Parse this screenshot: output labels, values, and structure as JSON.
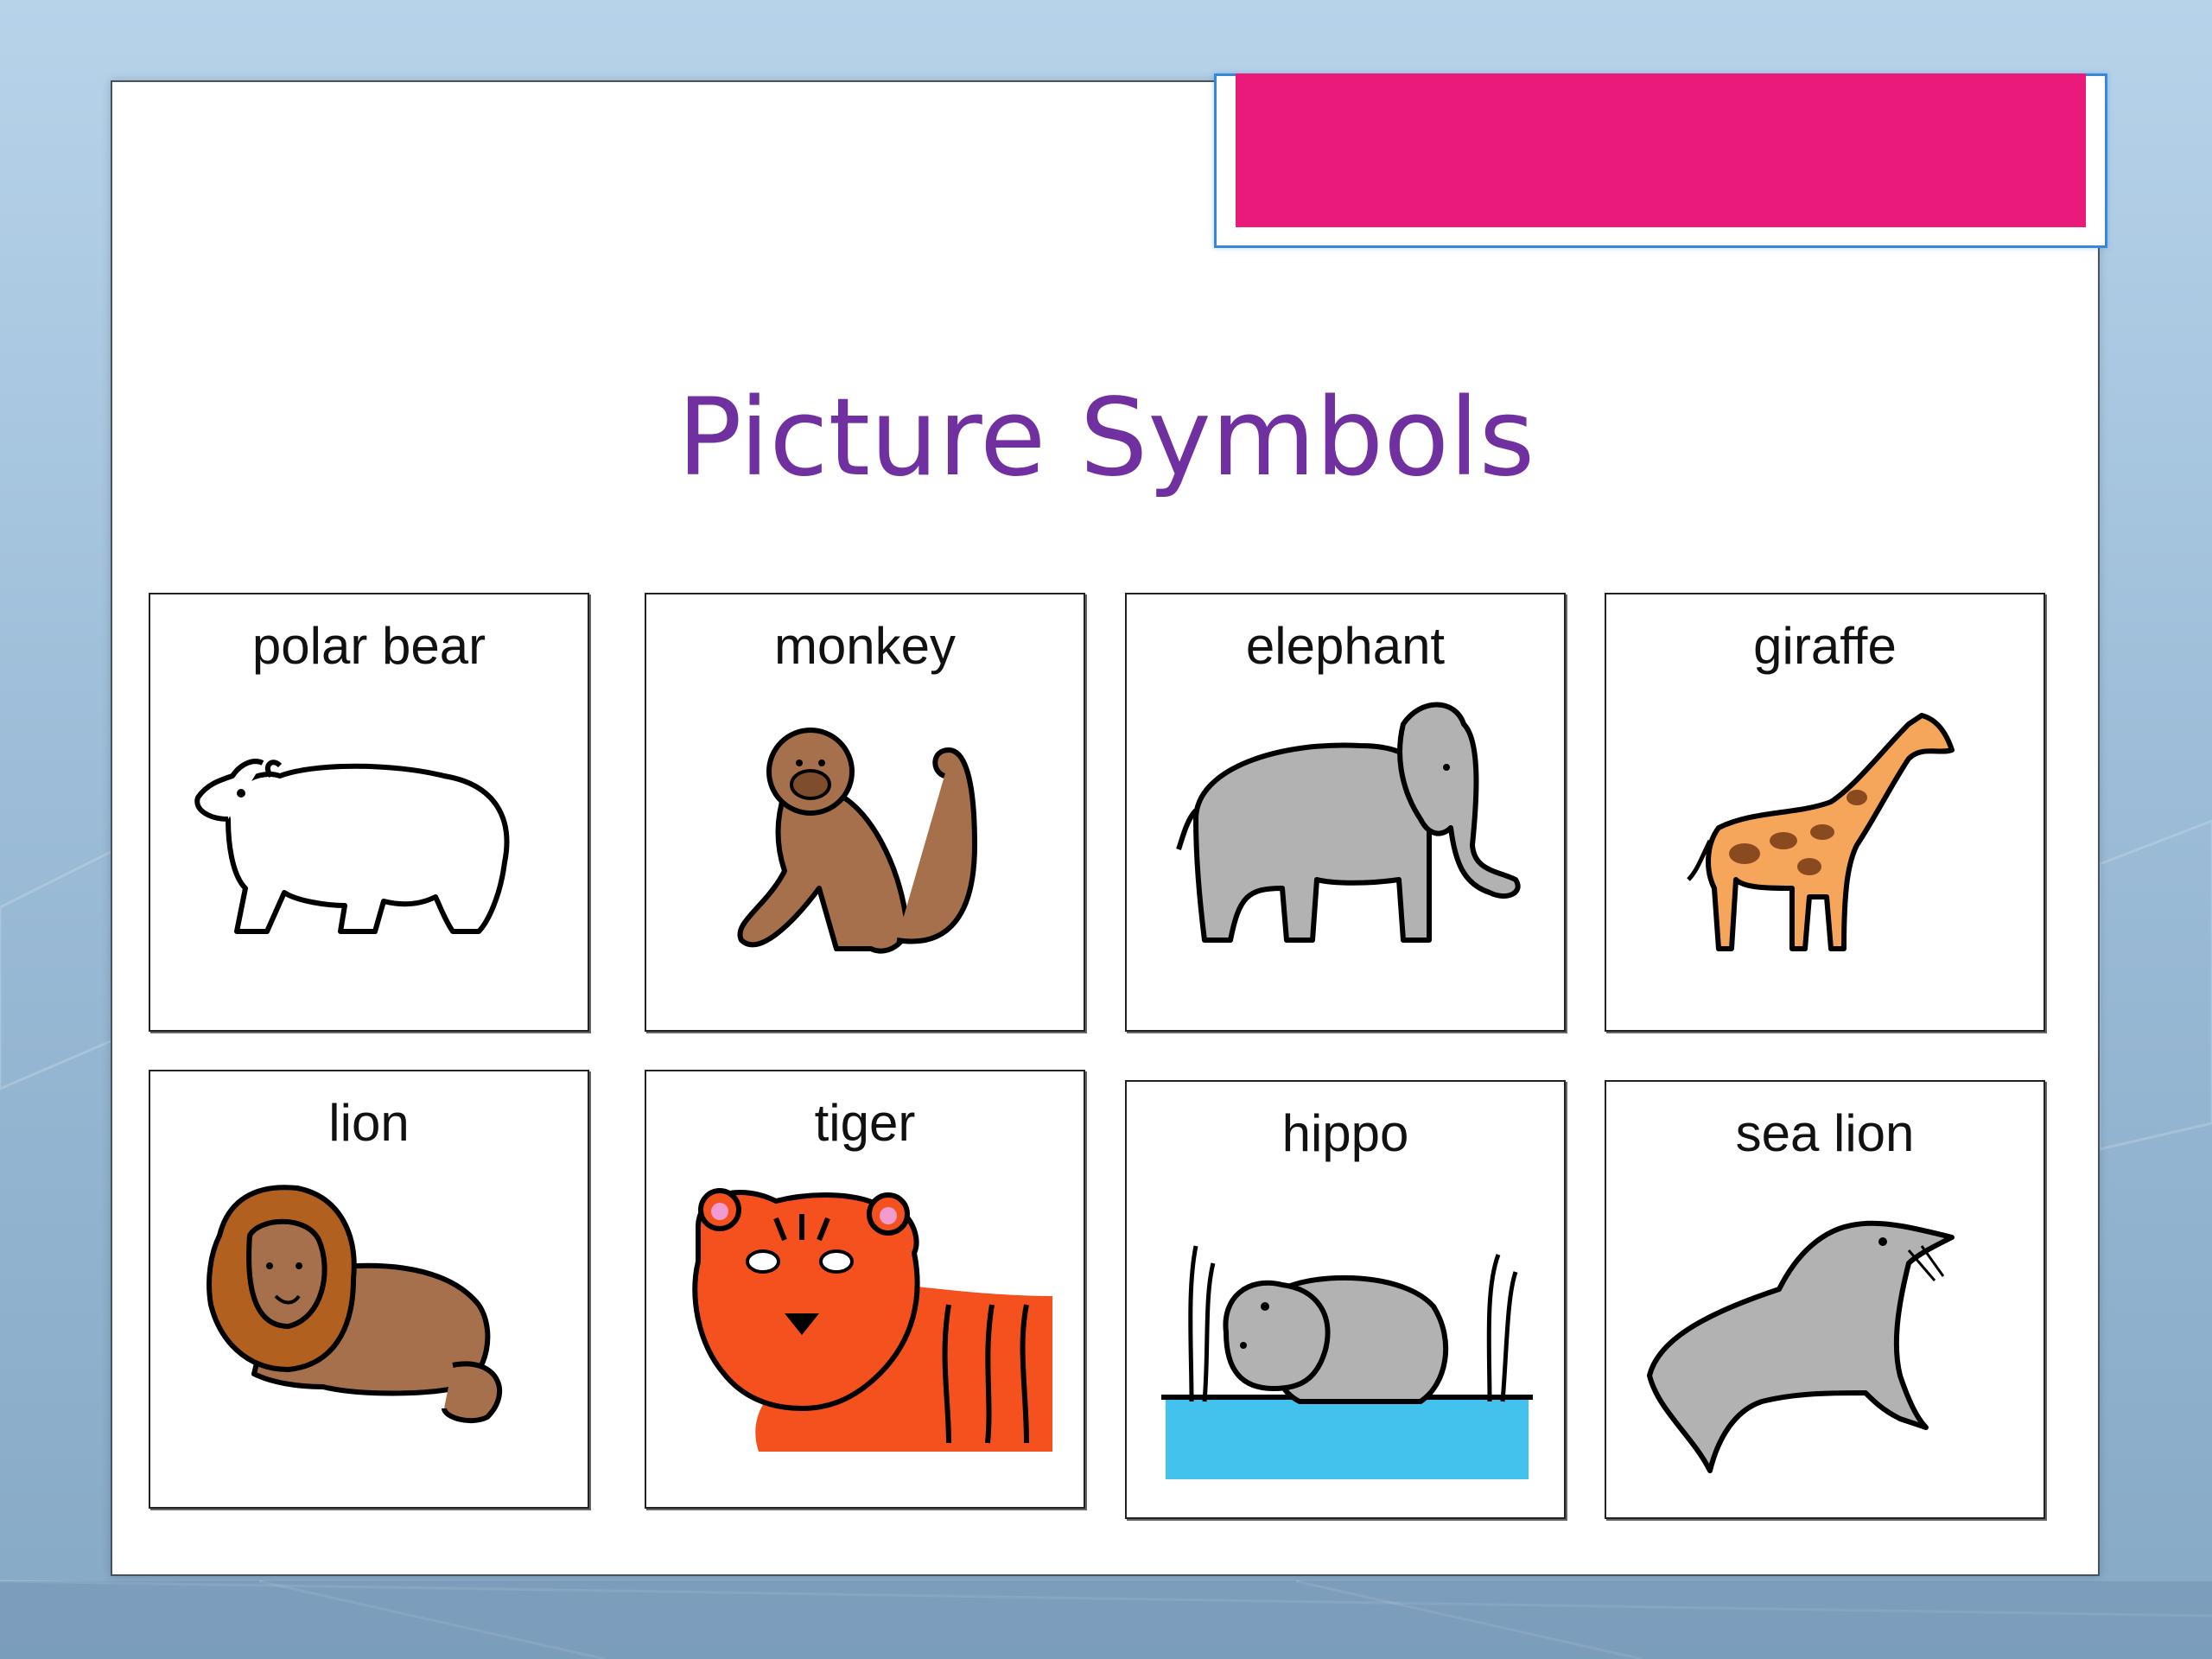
{
  "slide": {
    "title": "Picture Symbols"
  },
  "colors": {
    "title": "#7030a0",
    "accent_bar": "#e91a7a",
    "accent_frame": "#3a86d8",
    "background": "#9dbdd8"
  },
  "cards": [
    {
      "label": "polar bear",
      "icon": "polar-bear-icon"
    },
    {
      "label": "monkey",
      "icon": "monkey-icon"
    },
    {
      "label": "elephant",
      "icon": "elephant-icon"
    },
    {
      "label": "giraffe",
      "icon": "giraffe-icon"
    },
    {
      "label": "lion",
      "icon": "lion-icon"
    },
    {
      "label": "tiger",
      "icon": "tiger-icon"
    },
    {
      "label": "hippo",
      "icon": "hippo-icon"
    },
    {
      "label": "sea lion",
      "icon": "sea-lion-icon"
    }
  ]
}
